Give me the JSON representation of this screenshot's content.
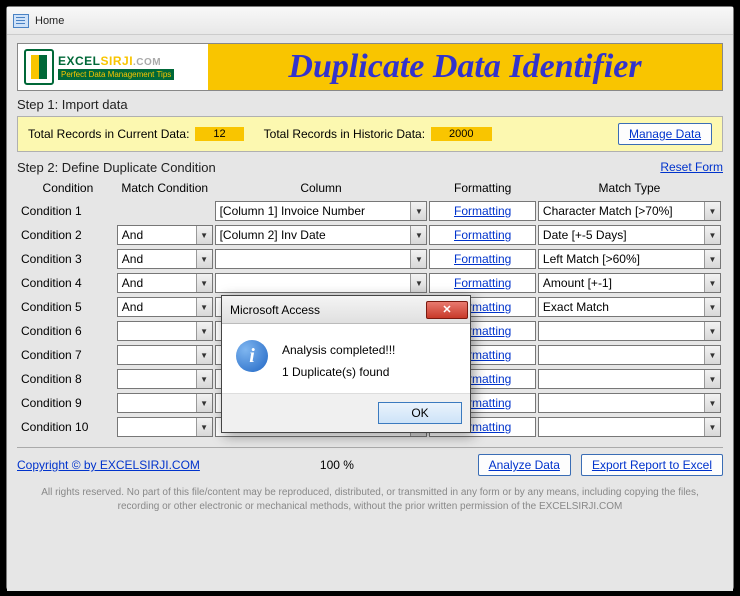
{
  "window": {
    "title": "Home"
  },
  "banner": {
    "logo_top_ex": "EXCEL",
    "logo_top_sirji": "SIRJI",
    "logo_top_com": ".COM",
    "logo_sub": "Perfect Data Management Tips",
    "title": "Duplicate Data Identifier"
  },
  "step1": {
    "label": "Step 1: Import data",
    "current_label": "Total Records in Current Data:",
    "current_value": "12",
    "historic_label": "Total Records in Historic Data:",
    "historic_value": "2000",
    "manage_btn": "Manage Data"
  },
  "step2": {
    "label": "Step 2: Define Duplicate Condition",
    "reset": "Reset Form",
    "headers": {
      "cond": "Condition",
      "mc": "Match Condition",
      "col": "Column",
      "fmt": "Formatting",
      "mt": "Match Type"
    },
    "formatting_label": "Formatting",
    "rows": [
      {
        "name": "Condition 1",
        "mc": "",
        "col": "[Column 1] Invoice Number",
        "mt": "Character Match [>70%]"
      },
      {
        "name": "Condition 2",
        "mc": "And",
        "col": "[Column 2] Inv Date",
        "mt": "Date [+-5 Days]"
      },
      {
        "name": "Condition 3",
        "mc": "And",
        "col": "",
        "mt": "Left Match [>60%]"
      },
      {
        "name": "Condition 4",
        "mc": "And",
        "col": "",
        "mt": "Amount [+-1]"
      },
      {
        "name": "Condition 5",
        "mc": "And",
        "col": "",
        "mt": "Exact Match"
      },
      {
        "name": "Condition 6",
        "mc": "",
        "col": "",
        "mt": ""
      },
      {
        "name": "Condition 7",
        "mc": "",
        "col": "",
        "mt": ""
      },
      {
        "name": "Condition 8",
        "mc": "",
        "col": "",
        "mt": ""
      },
      {
        "name": "Condition 9",
        "mc": "",
        "col": "",
        "mt": ""
      },
      {
        "name": "Condition 10",
        "mc": "",
        "col": "",
        "mt": ""
      }
    ]
  },
  "bottom": {
    "copyright": "Copyright © by EXCELSIRJI.COM",
    "progress": "100 %",
    "analyze": "Analyze Data",
    "export": "Export Report to Excel"
  },
  "footer": "All rights reserved. No part of this file/content may be reproduced, distributed, or transmitted in any form or by any means, including copying the files, recording or other electronic or mechanical methods, without the prior written permission of the EXCELSIRJI.COM",
  "dialog": {
    "title": "Microsoft Access",
    "line1": "Analysis completed!!!",
    "line2": "1 Duplicate(s) found",
    "ok": "OK"
  }
}
